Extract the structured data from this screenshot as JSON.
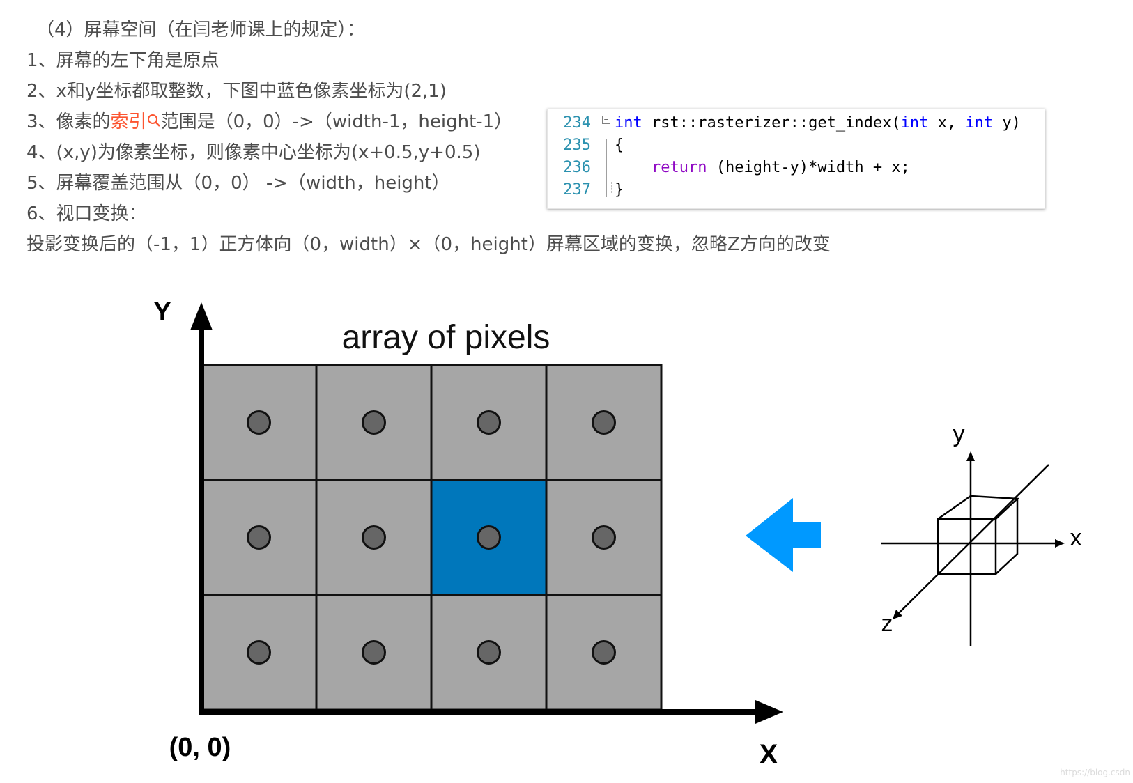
{
  "notes": {
    "heading": "（4）屏幕空间（在闫老师课上的规定）：",
    "line1": "1、屏幕的左下角是原点",
    "line2": "2、x和y坐标都取整数，下图中蓝色像素坐标为(2,1)",
    "line3_prefix": "3、像素的",
    "line3_link": "索引",
    "line3_suffix": "范围是（0，0）->（width-1，height-1）",
    "line4": "4、(x,y)为像素坐标，则像素中心坐标为(x+0.5,y+0.5)",
    "line5": "5、屏幕覆盖范围从（0，0） ->（width，height）",
    "line6": "6、视口变换：",
    "line7": "投影变换后的（-1，1）正方体向（0，width）×（0，height）屏幕区域的变换，忽略Z方向的改变"
  },
  "code": {
    "lines": [
      {
        "num": "234",
        "parts": [
          {
            "t": "int",
            "c": "k-blue"
          },
          {
            "t": " rst::rasterizer::get_index(",
            "c": ""
          },
          {
            "t": "int",
            "c": "k-blue"
          },
          {
            "t": " x, ",
            "c": ""
          },
          {
            "t": "int",
            "c": "k-blue"
          },
          {
            "t": " y)",
            "c": ""
          }
        ]
      },
      {
        "num": "235",
        "parts": [
          {
            "t": "{",
            "c": ""
          }
        ]
      },
      {
        "num": "236",
        "parts": [
          {
            "t": "    ",
            "c": ""
          },
          {
            "t": "return",
            "c": "k-purple"
          },
          {
            "t": " (height-y)*width + x;",
            "c": ""
          }
        ]
      },
      {
        "num": "237",
        "parts": [
          {
            "t": "}",
            "c": ""
          }
        ]
      }
    ]
  },
  "figure": {
    "title": "array of pixels",
    "axis_y": "Y",
    "axis_x": "X",
    "origin": "(0, 0)",
    "cols": 4,
    "rows": 3,
    "highlight": {
      "x": 2,
      "y": 1
    },
    "colors": {
      "cell": "#a6a6a6",
      "highlight": "#0077bb",
      "dot": "#666666",
      "arrow": "#0099ff"
    },
    "cube_axis_y": "y",
    "cube_axis_x": "x",
    "cube_axis_z": "z"
  },
  "watermark": "https://blog.csdn"
}
